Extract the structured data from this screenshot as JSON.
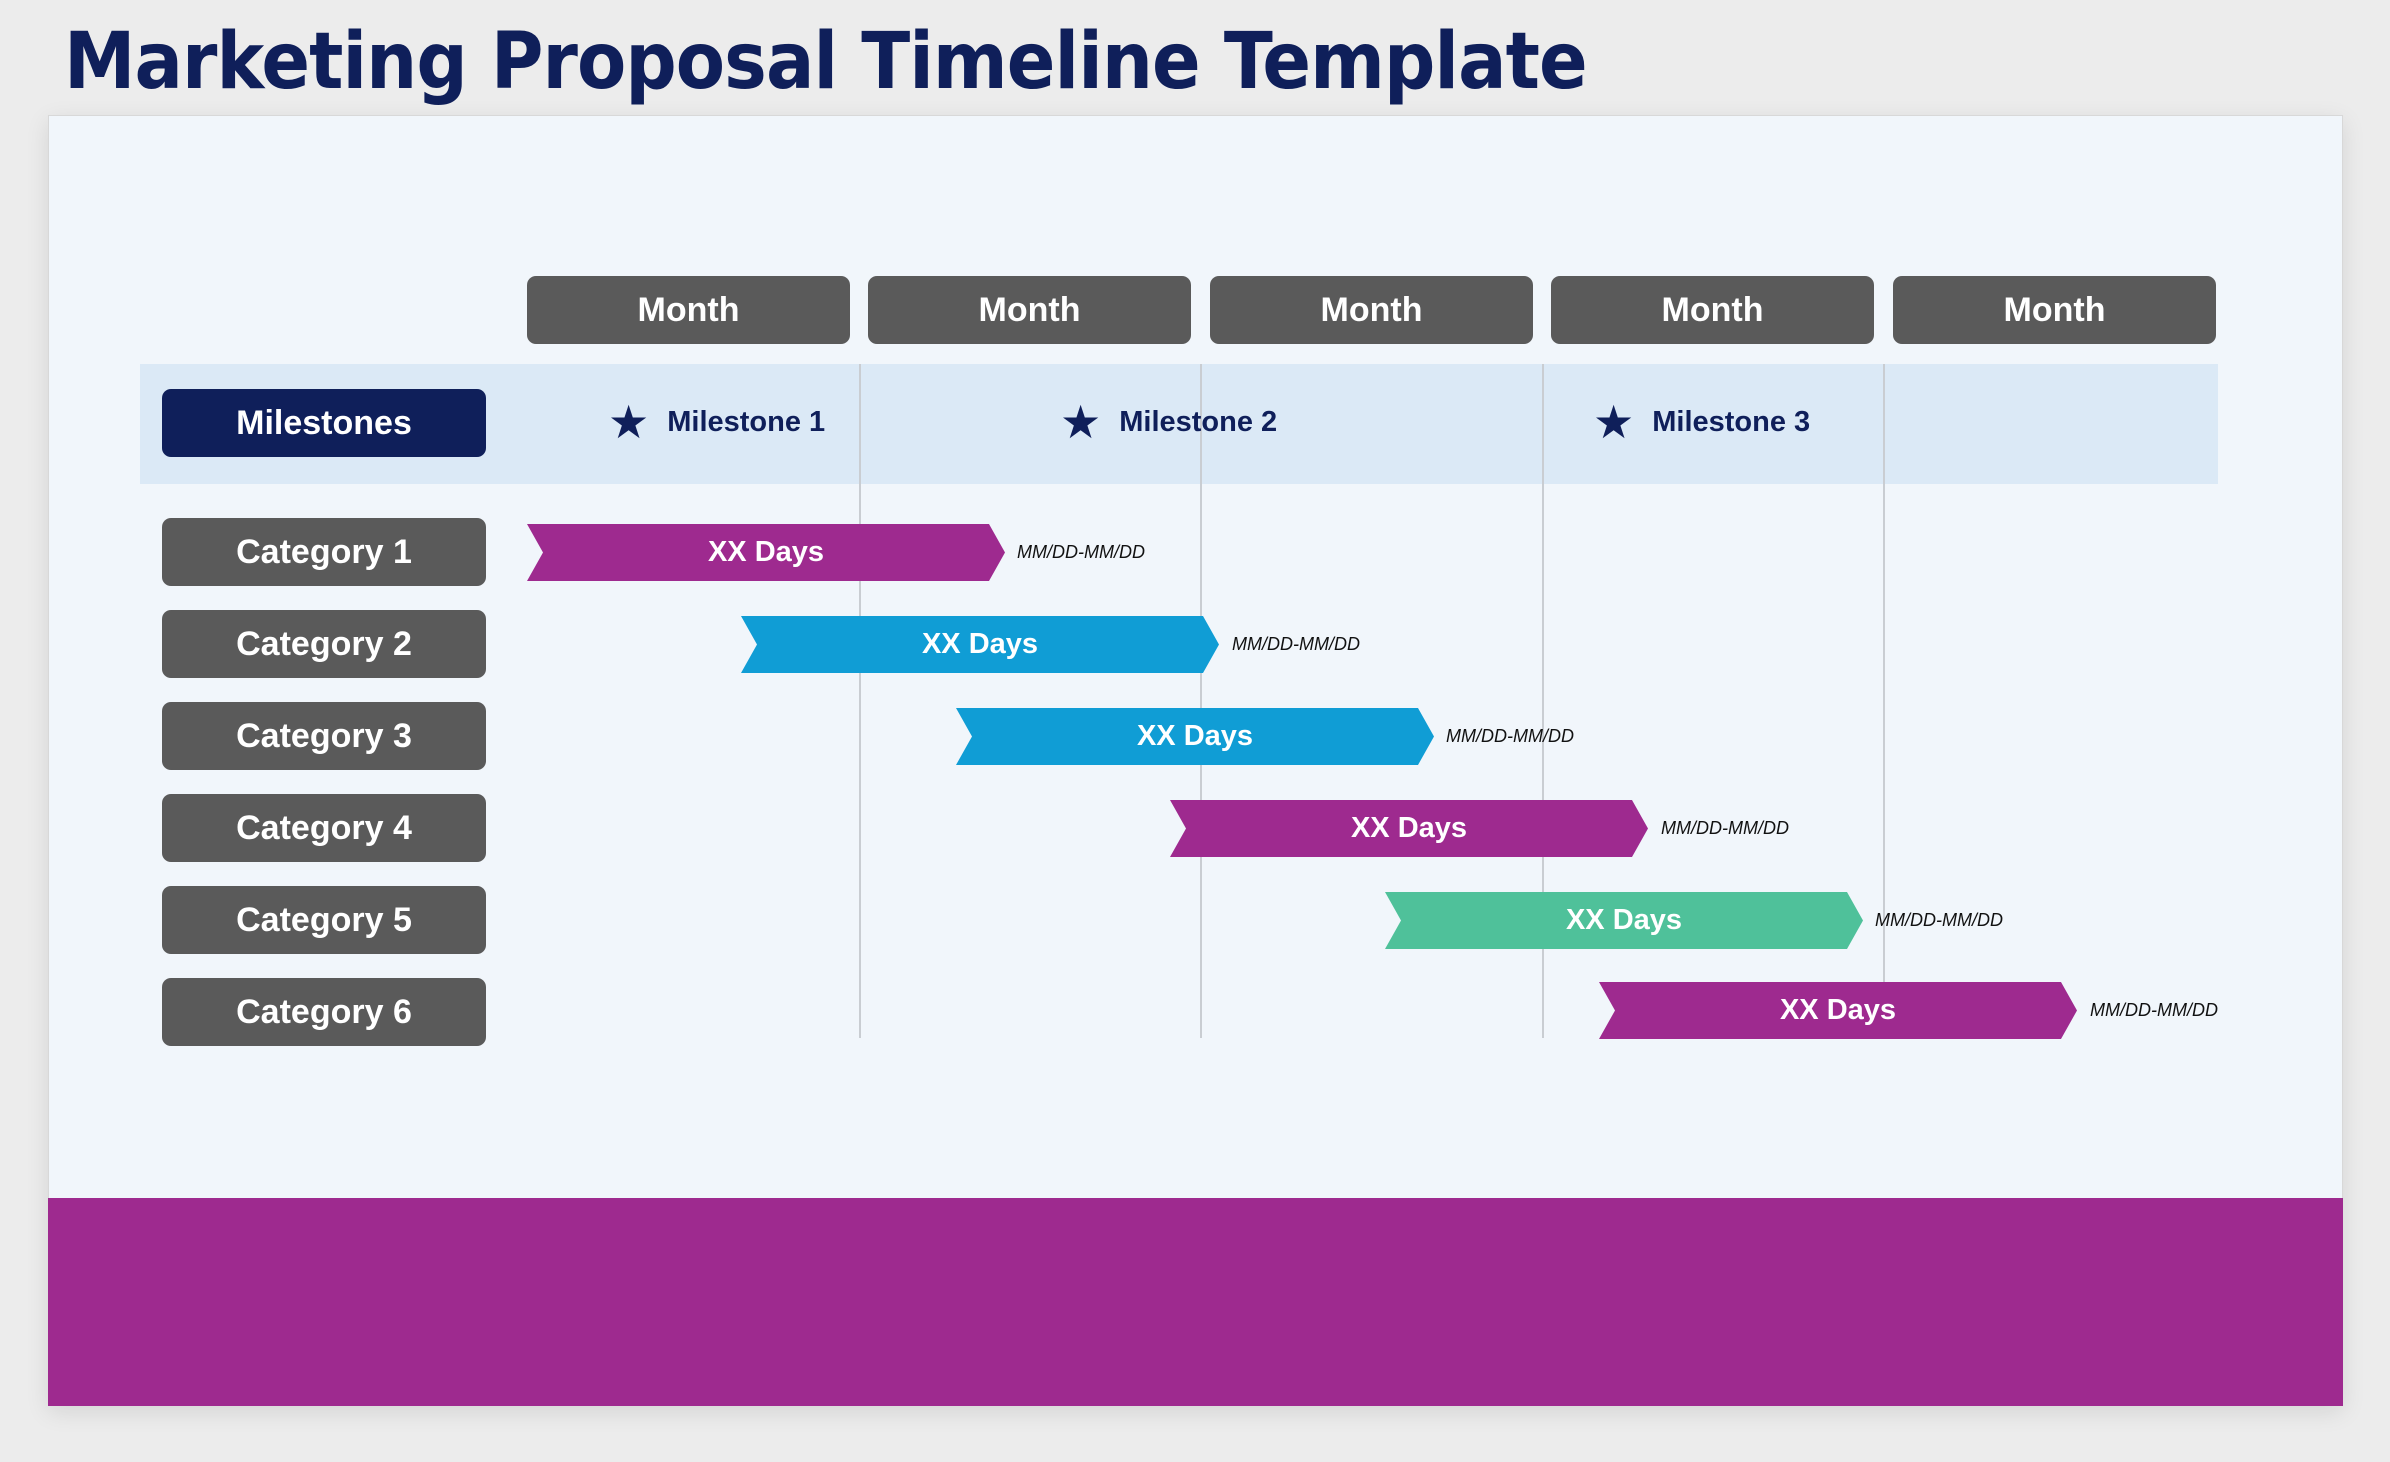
{
  "title": "Marketing Proposal Timeline Template",
  "months": [
    "Month",
    "Month",
    "Month",
    "Month",
    "Month"
  ],
  "milestones_label": "Milestones",
  "milestones": [
    {
      "label": "Milestone 1",
      "icon": "star-icon"
    },
    {
      "label": "Milestone 2",
      "icon": "star-icon"
    },
    {
      "label": "Milestone 3",
      "icon": "star-icon"
    }
  ],
  "star_glyph": "★",
  "colors": {
    "title": "#0f1f5a",
    "magenta": "#9e2a8f",
    "blue": "#109dd5",
    "green": "#4fc19a",
    "label_gray": "#5a5a5a",
    "milestone_navy": "#0f1f5a"
  },
  "categories": [
    {
      "label": "Category 1",
      "bar_text": "XX Days",
      "dates": "MM/DD-MM/DD",
      "color": "#9e2a8f"
    },
    {
      "label": "Category 2",
      "bar_text": "XX Days",
      "dates": "MM/DD-MM/DD",
      "color": "#109dd5"
    },
    {
      "label": "Category 3",
      "bar_text": "XX Days",
      "dates": "MM/DD-MM/DD",
      "color": "#109dd5"
    },
    {
      "label": "Category 4",
      "bar_text": "XX Days",
      "dates": "MM/DD-MM/DD",
      "color": "#9e2a8f"
    },
    {
      "label": "Category 5",
      "bar_text": "XX Days",
      "dates": "MM/DD-MM/DD",
      "color": "#4fc19a"
    },
    {
      "label": "Category 6",
      "bar_text": "XX Days",
      "dates": "MM/DD-MM/DD",
      "color": "#9e2a8f"
    }
  ]
}
